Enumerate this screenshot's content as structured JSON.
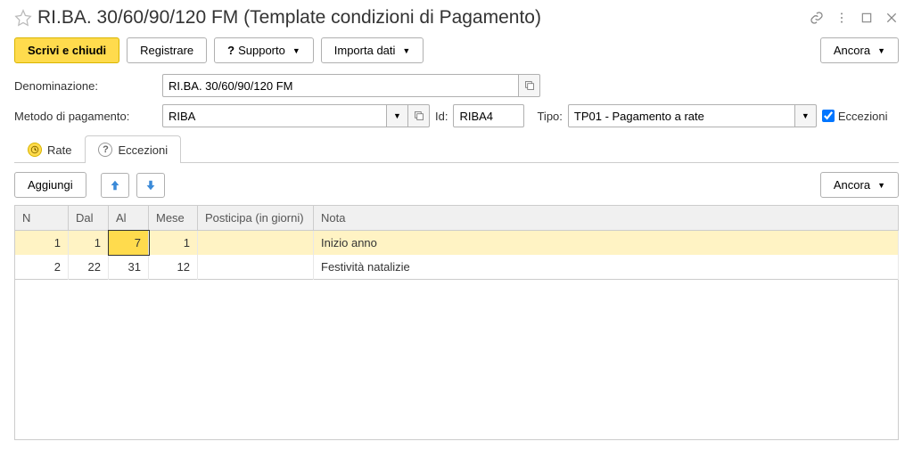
{
  "header": {
    "title": "RI.BA. 30/60/90/120 FM (Template condizioni di Pagamento)"
  },
  "toolbar": {
    "save_close": "Scrivi e chiudi",
    "register": "Registrare",
    "support": "Supporto",
    "import": "Importa dati",
    "more": "Ancora"
  },
  "form": {
    "denomination_label": "Denominazione:",
    "denomination_value": "RI.BA. 30/60/90/120 FM",
    "payment_method_label": "Metodo di pagamento:",
    "payment_method_value": "RIBA",
    "id_label": "Id:",
    "id_value": "RIBA4",
    "tipo_label": "Tipo:",
    "tipo_value": "TP01 - Pagamento a rate",
    "exceptions_label": "Eccezioni"
  },
  "tabs": {
    "rate": "Rate",
    "exceptions": "Eccezioni"
  },
  "table_toolbar": {
    "add": "Aggiungi",
    "more": "Ancora"
  },
  "table": {
    "headers": {
      "n": "N",
      "dal": "Dal",
      "al": "Al",
      "mese": "Mese",
      "posticipa": "Posticipa (in giorni)",
      "nota": "Nota"
    },
    "rows": [
      {
        "n": "1",
        "dal": "1",
        "al": "7",
        "mese": "1",
        "posticipa": "",
        "nota": "Inizio anno"
      },
      {
        "n": "2",
        "dal": "22",
        "al": "31",
        "mese": "12",
        "posticipa": "",
        "nota": "Festività natalizie"
      }
    ]
  }
}
